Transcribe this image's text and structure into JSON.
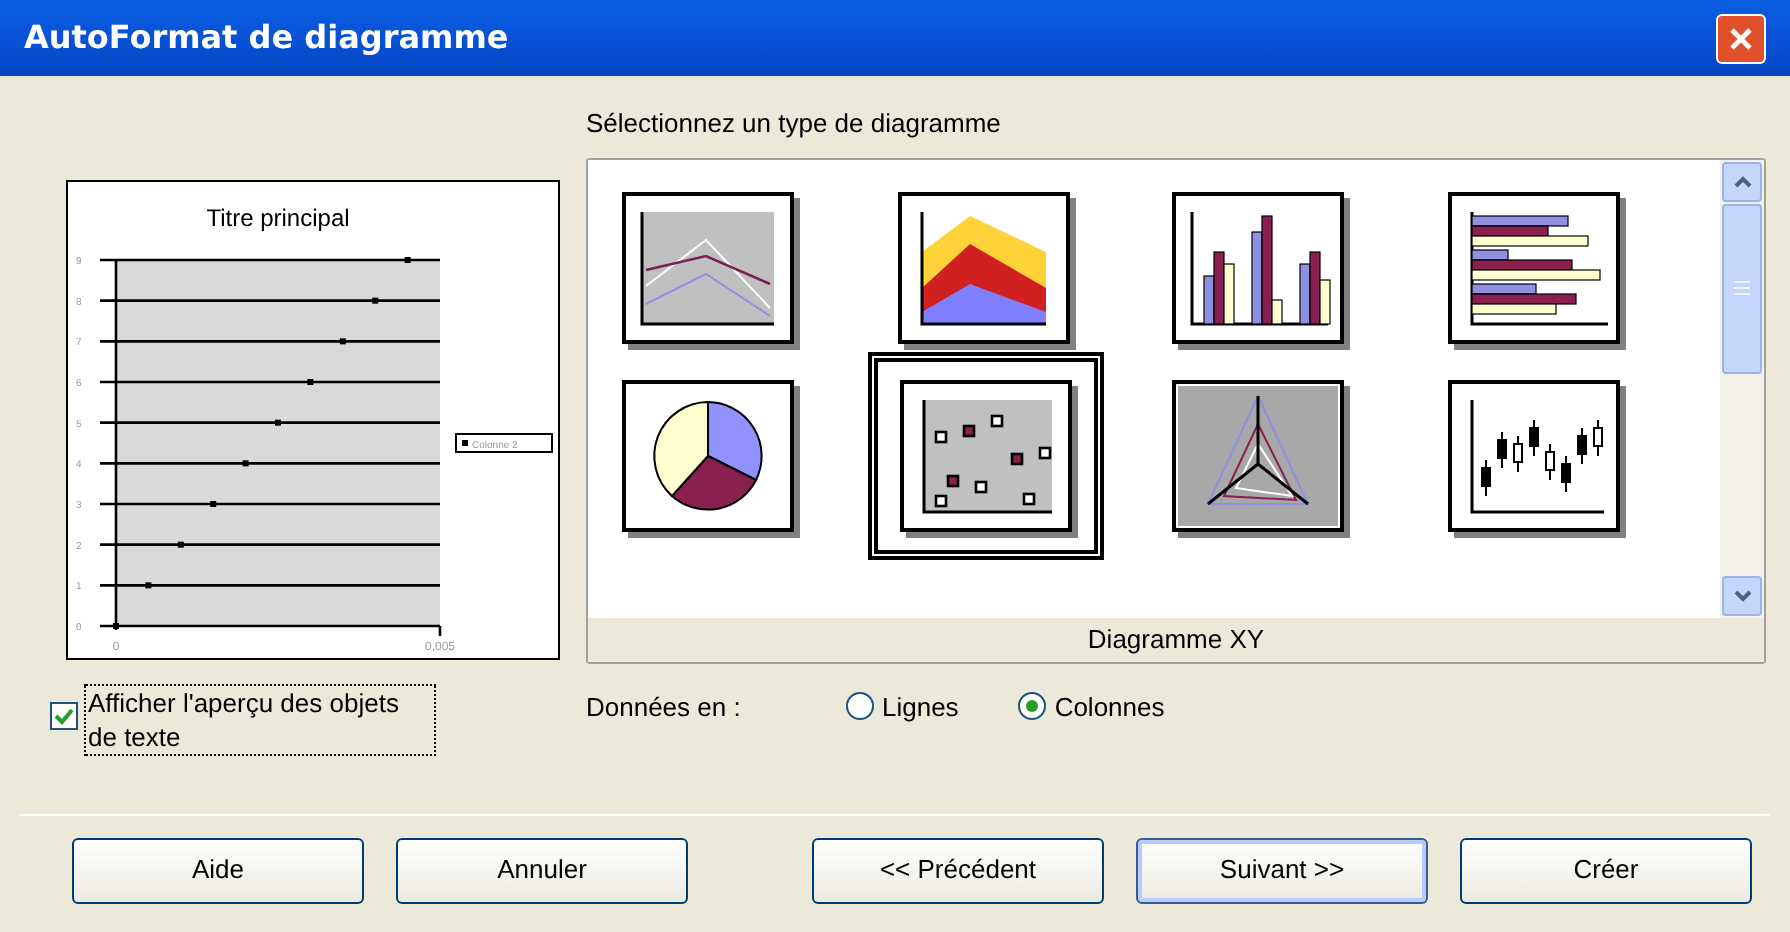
{
  "window": {
    "title": "AutoFormat de diagramme"
  },
  "preview": {
    "chart_data": {
      "type": "scatter",
      "title": "Titre principal",
      "series": [
        {
          "name": "Colonne 2",
          "color": "#000000",
          "values": [
            0,
            1,
            2,
            3,
            4,
            5,
            6,
            7,
            8,
            9
          ]
        }
      ],
      "x": [
        0,
        0.0005,
        0.001,
        0.0015,
        0.002,
        0.0025,
        0.003,
        0.0035,
        0.004,
        0.0045
      ],
      "grid": true,
      "xlim": [
        0,
        0.005
      ],
      "ylim": [
        0,
        9
      ],
      "xticks": [
        0,
        {
          "value": 0.005,
          "label": "0,005"
        }
      ],
      "yticks": [
        0,
        1,
        2,
        3,
        4,
        5,
        6,
        7,
        8,
        9
      ]
    }
  },
  "show_text_preview": {
    "label": "Afficher l'aperçu des objets de texte",
    "checked": true
  },
  "gallery": {
    "label": "Sélectionnez un type de diagramme",
    "items": [
      {
        "kind": "line",
        "selected": false
      },
      {
        "kind": "area",
        "selected": false
      },
      {
        "kind": "column",
        "selected": false
      },
      {
        "kind": "bar",
        "selected": false
      },
      {
        "kind": "pie",
        "selected": false
      },
      {
        "kind": "xy",
        "selected": true
      },
      {
        "kind": "net",
        "selected": false
      },
      {
        "kind": "stock",
        "selected": false
      }
    ],
    "caption": "Diagramme XY"
  },
  "data_in": {
    "label": "Données en :",
    "options": [
      {
        "label": "Lignes",
        "selected": false
      },
      {
        "label": "Colonnes",
        "selected": true
      }
    ]
  },
  "buttons": [
    {
      "label": "Aide",
      "default": false
    },
    {
      "label": "Annuler",
      "default": false
    },
    {
      "label": "<< Précédent",
      "default": false
    },
    {
      "label": "Suivant >>",
      "default": true
    },
    {
      "label": "Créer",
      "default": false
    }
  ]
}
